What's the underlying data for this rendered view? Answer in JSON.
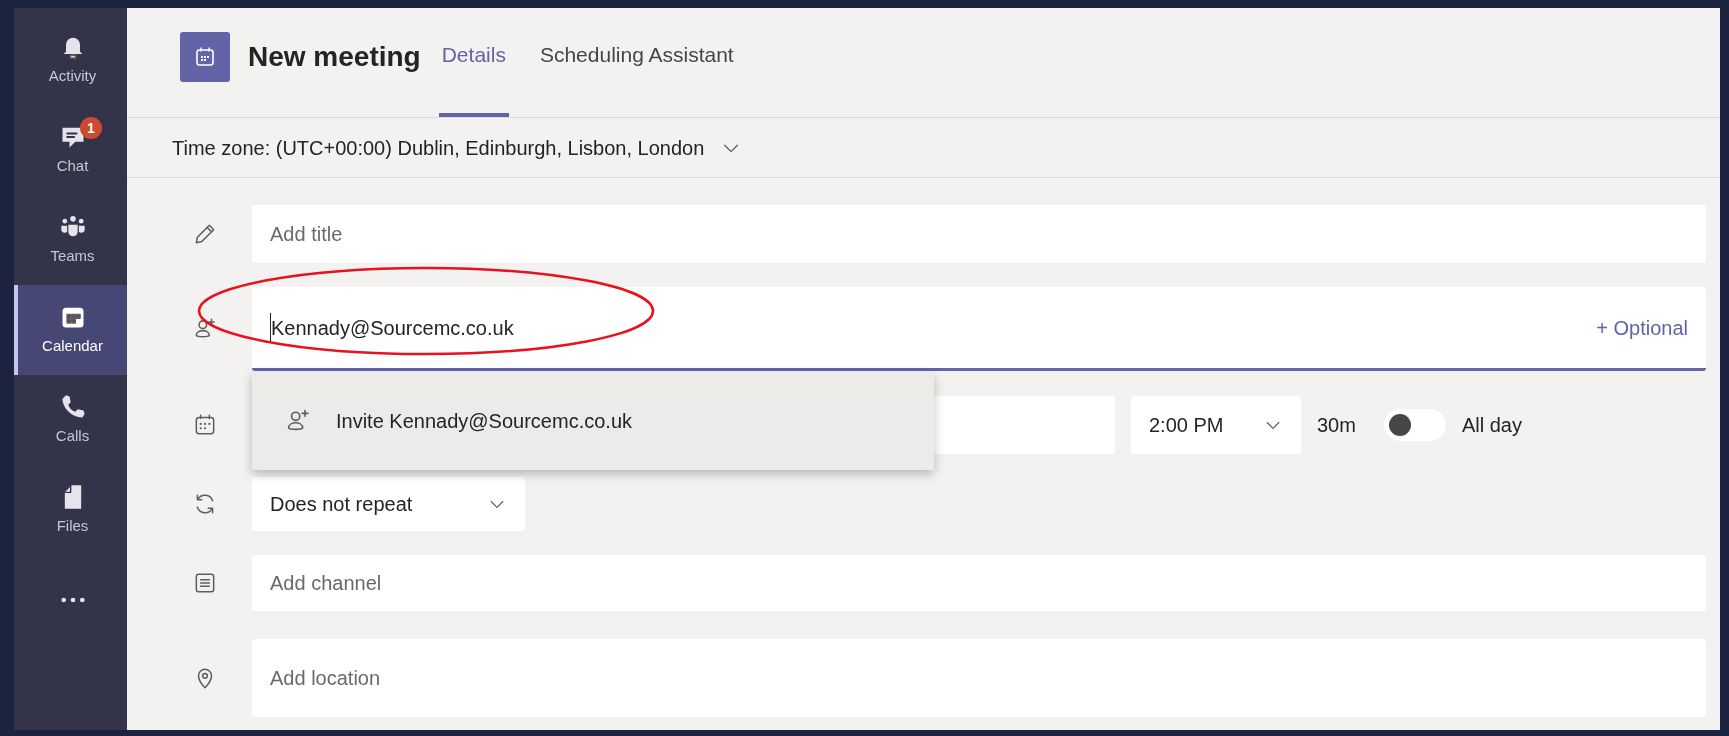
{
  "sidebar": {
    "items": [
      {
        "kind": "bell",
        "label": "Activity",
        "selected": false
      },
      {
        "kind": "chat",
        "label": "Chat",
        "selected": false,
        "badge": "1"
      },
      {
        "kind": "teams",
        "label": "Teams",
        "selected": false
      },
      {
        "kind": "calendar",
        "label": "Calendar",
        "selected": true
      },
      {
        "kind": "phone",
        "label": "Calls",
        "selected": false
      },
      {
        "kind": "file",
        "label": "Files",
        "selected": false
      },
      {
        "kind": "more"
      }
    ]
  },
  "header": {
    "title": "New meeting",
    "tabs": [
      {
        "label": "Details",
        "selected": true
      },
      {
        "label": "Scheduling Assistant",
        "selected": false
      }
    ]
  },
  "time_zone": {
    "label": "Time zone: (UTC+00:00) Dublin, Edinburgh, Lisbon, London"
  },
  "form": {
    "title_field": {
      "placeholder": "Add title"
    },
    "attendees": {
      "value": "Kennady@Sourcemc.co.uk",
      "optional_link": "+ Optional"
    },
    "suggestion": {
      "label": "Invite Kennady@Sourcemc.co.uk"
    },
    "time": {
      "start_time": "2:00 PM",
      "duration": "30m",
      "all_day": {
        "label": "All day",
        "on": false
      }
    },
    "repeat": {
      "value": "Does not repeat"
    },
    "channel": {
      "placeholder": "Add channel"
    },
    "location": {
      "placeholder": "Add location"
    }
  }
}
